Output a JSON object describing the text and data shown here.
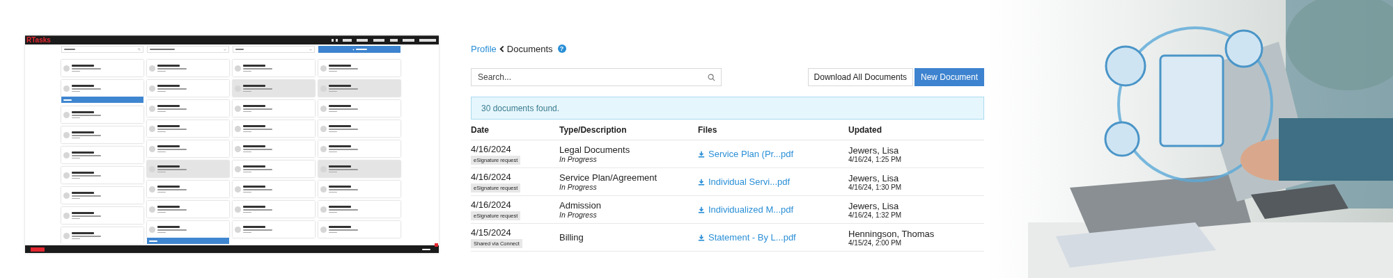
{
  "resident_app": {
    "logo": "RTasks",
    "columns": [
      {
        "cards": [
          {
            "shaded": false,
            "notice": false
          },
          {
            "shaded": false,
            "notice": true
          },
          {
            "shaded": false,
            "notice": false
          },
          {
            "shaded": false,
            "notice": false
          },
          {
            "shaded": false,
            "notice": false
          },
          {
            "shaded": false,
            "notice": false
          },
          {
            "shaded": false,
            "notice": false
          },
          {
            "shaded": false,
            "notice": false
          },
          {
            "shaded": false,
            "notice": false
          }
        ]
      },
      {
        "cards": [
          {
            "shaded": false,
            "notice": false
          },
          {
            "shaded": false,
            "notice": false
          },
          {
            "shaded": false,
            "notice": false
          },
          {
            "shaded": false,
            "notice": false
          },
          {
            "shaded": false,
            "notice": false
          },
          {
            "shaded": true,
            "notice": false
          },
          {
            "shaded": false,
            "notice": false
          },
          {
            "shaded": false,
            "notice": false
          },
          {
            "shaded": false,
            "notice": true
          }
        ]
      },
      {
        "cards": [
          {
            "shaded": false,
            "notice": false
          },
          {
            "shaded": true,
            "notice": false
          },
          {
            "shaded": false,
            "notice": false
          },
          {
            "shaded": false,
            "notice": false
          },
          {
            "shaded": false,
            "notice": false
          },
          {
            "shaded": false,
            "notice": false
          },
          {
            "shaded": false,
            "notice": false
          },
          {
            "shaded": false,
            "notice": false
          },
          {
            "shaded": false,
            "notice": false
          }
        ]
      },
      {
        "cards": [
          {
            "shaded": false,
            "notice": false
          },
          {
            "shaded": true,
            "notice": false
          },
          {
            "shaded": false,
            "notice": false
          },
          {
            "shaded": false,
            "notice": false
          },
          {
            "shaded": false,
            "notice": false
          },
          {
            "shaded": true,
            "notice": false
          },
          {
            "shaded": false,
            "notice": false
          },
          {
            "shaded": false,
            "notice": false
          },
          {
            "shaded": false,
            "notice": false
          }
        ]
      }
    ]
  },
  "documents": {
    "breadcrumb": {
      "link": "Profile",
      "current": "Documents",
      "help": "?"
    },
    "search_placeholder": "Search...",
    "buttons": [
      "Download All Documents",
      "New Document"
    ],
    "alert": "30 documents found.",
    "columns": [
      "Date",
      "Type/Description",
      "Files",
      "Updated"
    ],
    "rows": [
      {
        "date": "4/16/2024",
        "tag": "eSignature request",
        "type": "Legal Documents",
        "status": "In Progress",
        "file": "Service Plan (Pr...pdf",
        "updated_by": "Jewers, Lisa",
        "updated_at": "4/16/24, 1:25 PM"
      },
      {
        "date": "4/16/2024",
        "tag": "eSignature request",
        "type": "Service Plan/Agreement",
        "status": "In Progress",
        "file": "Individual Servi...pdf",
        "updated_by": "Jewers, Lisa",
        "updated_at": "4/16/24, 1:30 PM"
      },
      {
        "date": "4/16/2024",
        "tag": "eSignature request",
        "type": "Admission",
        "status": "In Progress",
        "file": "Individualized M...pdf",
        "updated_by": "Jewers, Lisa",
        "updated_at": "4/16/24, 1:32 PM"
      },
      {
        "date": "4/15/2024",
        "tag": "Shared via Connect",
        "type": "Billing",
        "file": "Statement - By L...pdf",
        "updated_by": "Henningson, Thomas",
        "updated_at": "4/15/24, 2:00 PM"
      }
    ]
  }
}
